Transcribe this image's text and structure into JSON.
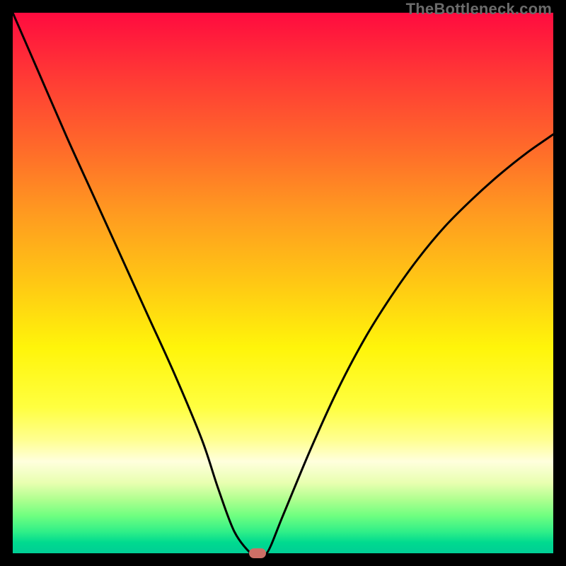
{
  "watermark": "TheBottleneck.com",
  "chart_data": {
    "type": "line",
    "title": "",
    "xlabel": "",
    "ylabel": "",
    "xlim": [
      0,
      100
    ],
    "ylim": [
      0,
      100
    ],
    "x": [
      0,
      5,
      10,
      15,
      20,
      25,
      30,
      35,
      38,
      41,
      44,
      45,
      47,
      50,
      55,
      60,
      65,
      70,
      75,
      80,
      85,
      90,
      95,
      100
    ],
    "y": [
      100,
      88.5,
      77,
      66,
      55,
      44,
      33,
      21,
      12,
      4,
      0,
      0,
      0,
      7,
      19,
      30,
      39.5,
      47.5,
      54.5,
      60.5,
      65.5,
      70,
      74,
      77.5
    ],
    "marker": {
      "x": 45.3,
      "y": 0
    },
    "gradient_axis": "y",
    "gradient_stops": [
      {
        "pos": 0,
        "color": "#00ce95"
      },
      {
        "pos": 5,
        "color": "#30ef88"
      },
      {
        "pos": 12,
        "color": "#b0ff90"
      },
      {
        "pos": 18,
        "color": "#ffffdd"
      },
      {
        "pos": 30,
        "color": "#fff50a"
      },
      {
        "pos": 50,
        "color": "#ffc814"
      },
      {
        "pos": 75,
        "color": "#ff6a2a"
      },
      {
        "pos": 100,
        "color": "#ff0b3f"
      }
    ]
  }
}
